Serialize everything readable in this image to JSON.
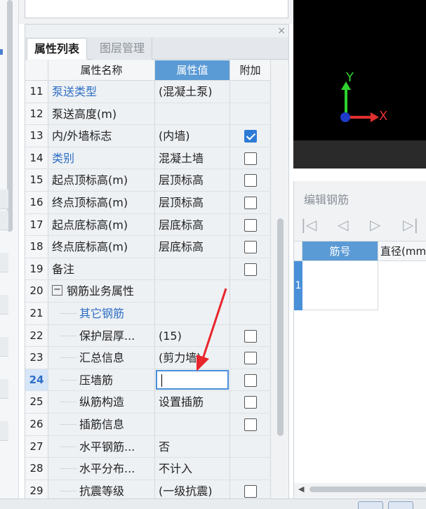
{
  "property_panel": {
    "close_icon": "×",
    "tabs": [
      {
        "label": "属性列表",
        "active": true
      },
      {
        "label": "图层管理",
        "active": false
      }
    ],
    "columns": {
      "name": "属性名称",
      "value": "属性值",
      "attach": "附加"
    },
    "rows": [
      {
        "num": "11",
        "name": "泵送类型",
        "value": "(混凝土泵)",
        "checkbox": false,
        "checked": false,
        "blue": true
      },
      {
        "num": "12",
        "name": "泵送高度(m)",
        "value": "",
        "checkbox": false,
        "checked": false,
        "blue": false
      },
      {
        "num": "13",
        "name": "内/外墙标志",
        "value": "(内墙)",
        "checkbox": true,
        "checked": true,
        "blue": false
      },
      {
        "num": "14",
        "name": "类别",
        "value": "混凝土墙",
        "checkbox": true,
        "checked": false,
        "blue": true
      },
      {
        "num": "15",
        "name": "起点顶标高(m)",
        "value": "层顶标高",
        "checkbox": true,
        "checked": false,
        "blue": false
      },
      {
        "num": "16",
        "name": "终点顶标高(m)",
        "value": "层顶标高",
        "checkbox": true,
        "checked": false,
        "blue": false
      },
      {
        "num": "17",
        "name": "起点底标高(m)",
        "value": "层底标高",
        "checkbox": true,
        "checked": false,
        "blue": false
      },
      {
        "num": "18",
        "name": "终点底标高(m)",
        "value": "层底标高",
        "checkbox": true,
        "checked": false,
        "blue": false
      },
      {
        "num": "19",
        "name": "备注",
        "value": "",
        "checkbox": true,
        "checked": false,
        "blue": false
      },
      {
        "num": "20",
        "name": "钢筋业务属性",
        "value": "",
        "checkbox": false,
        "checked": false,
        "blue": false,
        "expander": "−"
      },
      {
        "num": "21",
        "name": "其它钢筋",
        "value": "",
        "checkbox": false,
        "checked": false,
        "blue": true,
        "child": true
      },
      {
        "num": "22",
        "name": "保护层厚...",
        "value": "(15)",
        "checkbox": true,
        "checked": false,
        "blue": false,
        "child": true
      },
      {
        "num": "23",
        "name": "汇总信息",
        "value": "(剪力墙)",
        "checkbox": true,
        "checked": false,
        "blue": false,
        "child": true
      },
      {
        "num": "24",
        "name": "压墙筋",
        "value": "",
        "checkbox": true,
        "checked": false,
        "blue": false,
        "child": true,
        "editing": true
      },
      {
        "num": "25",
        "name": "纵筋构造",
        "value": "设置插筋",
        "checkbox": true,
        "checked": false,
        "blue": false,
        "child": true
      },
      {
        "num": "26",
        "name": "插筋信息",
        "value": "",
        "checkbox": true,
        "checked": false,
        "blue": false,
        "child": true
      },
      {
        "num": "27",
        "name": "水平钢筋...",
        "value": "否",
        "checkbox": false,
        "checked": false,
        "blue": false,
        "child": true
      },
      {
        "num": "28",
        "name": "水平分布...",
        "value": "不计入",
        "checkbox": false,
        "checked": false,
        "blue": false,
        "child": true
      },
      {
        "num": "29",
        "name": "抗震等级",
        "value": "(一级抗震)",
        "checkbox": true,
        "checked": false,
        "blue": false,
        "child": true
      }
    ]
  },
  "viewport": {
    "axis_y": "Y",
    "axis_x": "X"
  },
  "edit_rebar": {
    "title": "编辑钢筋",
    "nav": [
      "|◁",
      "◁",
      "▷",
      "▷|"
    ],
    "columns": {
      "bar_no": "筋号",
      "diameter": "直径(mm"
    },
    "row_num": "1"
  },
  "colors": {
    "header_blue": "#5b9bd5",
    "link_blue": "#2d6ec4",
    "check_blue": "#2d7bd6",
    "arrow_red": "#e8262c"
  }
}
